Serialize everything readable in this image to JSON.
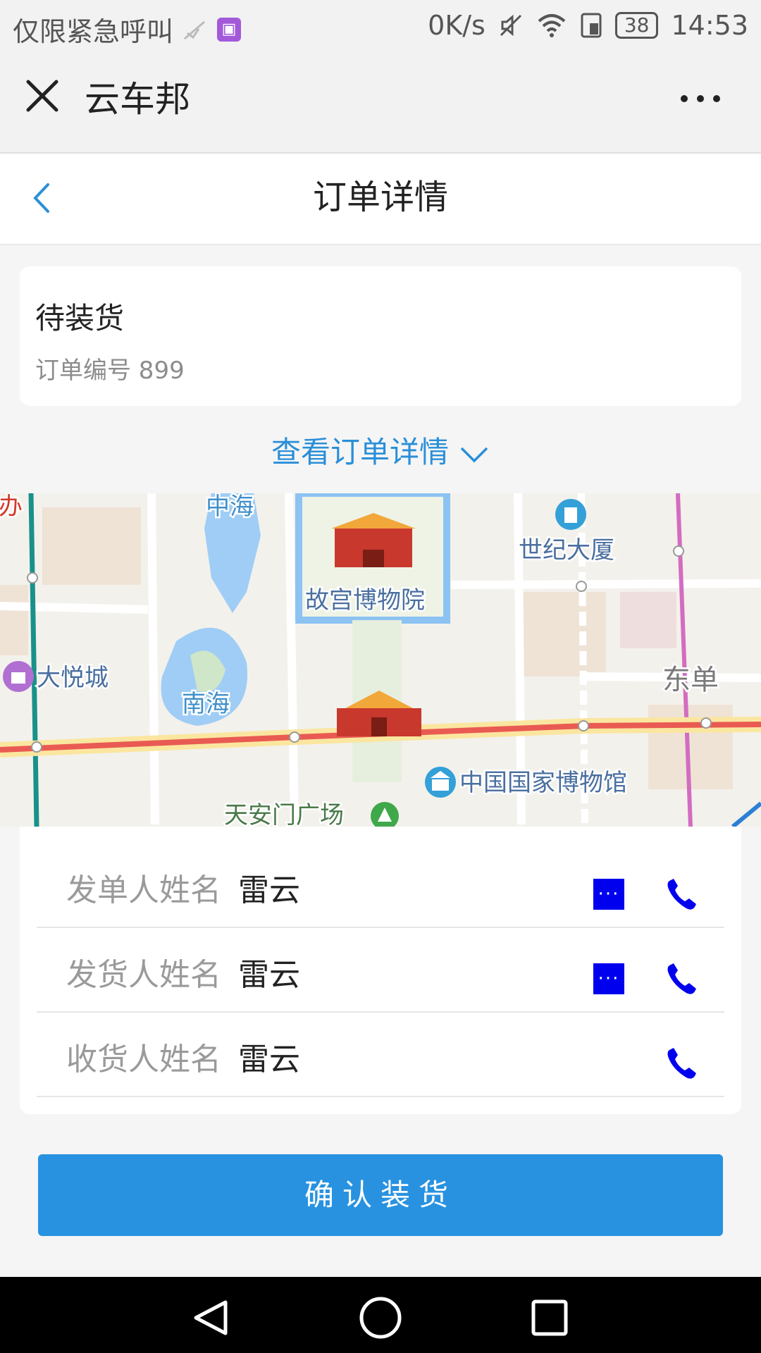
{
  "status_bar": {
    "carrier": "仅限紧急呼叫",
    "speed": "0K/s",
    "battery": "38",
    "time": "14:53"
  },
  "app": {
    "title": "云车邦"
  },
  "page": {
    "title": "订单详情"
  },
  "order": {
    "status": "待装货",
    "number_label": "订单编号 899"
  },
  "view_details_label": "查看订单详情",
  "map": {
    "labels": {
      "zhonghai": "中海",
      "palace": "故宫博物院",
      "century": "世纪大厦",
      "joycity": "大悦城",
      "nanhai": "南海",
      "dongdan": "东单",
      "museum": "中国国家博物馆",
      "tiananmen": "天安门广场",
      "edge": "办"
    }
  },
  "contacts": [
    {
      "label": "发单人姓名",
      "name": "雷云",
      "has_message": true
    },
    {
      "label": "发货人姓名",
      "name": "雷云",
      "has_message": true
    },
    {
      "label": "收货人姓名",
      "name": "雷云",
      "has_message": false
    }
  ],
  "message_glyph": "···",
  "confirm_button": "确认装货",
  "colors": {
    "accent": "#2892e0",
    "link": "#2a8fd8",
    "contact_icon": "#0000ee",
    "road_main": "#e95b52"
  }
}
